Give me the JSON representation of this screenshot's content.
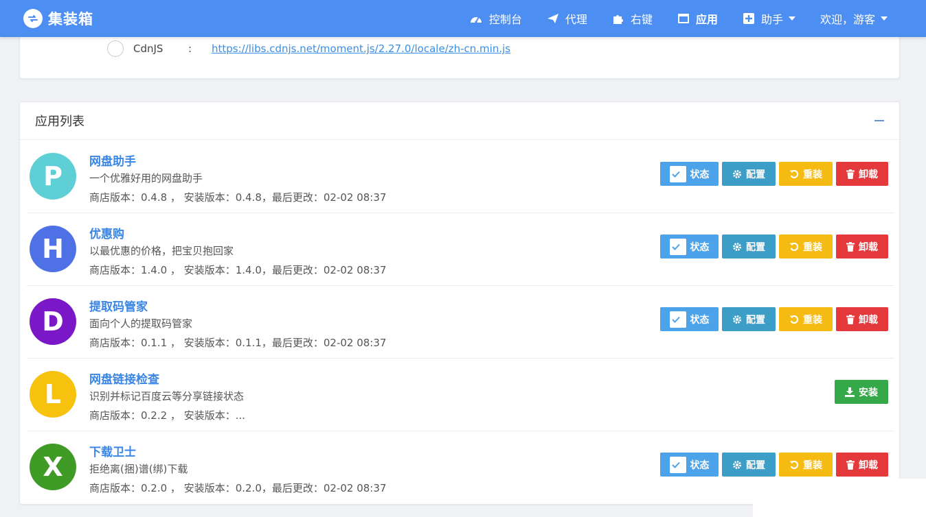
{
  "navbar": {
    "brand": "集装箱",
    "items": [
      {
        "label": "控制台",
        "icon": "dashboard-icon"
      },
      {
        "label": "代理",
        "icon": "paper-plane-icon"
      },
      {
        "label": "右键",
        "icon": "puzzle-icon"
      },
      {
        "label": "应用",
        "icon": "window-icon"
      },
      {
        "label": "助手",
        "icon": "plus-square-icon"
      }
    ],
    "welcome": "欢迎，游客"
  },
  "cdn": {
    "label": "CdnJS",
    "separator": ":",
    "url": "https://libs.cdnjs.net/moment.js/2.27.0/locale/zh-cn.min.js"
  },
  "app_list": {
    "title": "应用列表",
    "buttons": {
      "status": "状态",
      "config": "配置",
      "reinstall": "重装",
      "uninstall": "卸载",
      "install": "安装"
    },
    "apps": [
      {
        "letter": "P",
        "color": "#5fcfd6",
        "name": "网盘助手",
        "desc": "一个优雅好用的网盘助手",
        "meta": "商店版本：0.4.8 ， 安装版本：0.4.8，最后更改：02-02 08:37"
      },
      {
        "letter": "H",
        "color": "#4f71e6",
        "name": "优惠购",
        "desc": "以最优惠的价格，把宝贝抱回家",
        "meta": "商店版本：1.4.0 ， 安装版本：1.4.0，最后更改：02-02 08:37"
      },
      {
        "letter": "D",
        "color": "#7a17c6",
        "name": "提取码管家",
        "desc": "面向个人的提取码管家",
        "meta": "商店版本：0.1.1 ， 安装版本：0.1.1，最后更改：02-02 08:37"
      },
      {
        "letter": "L",
        "color": "#f7c20e",
        "name": "网盘链接检查",
        "desc": "识别并标记百度云等分享链接状态",
        "meta": "商店版本：0.2.2 ， 安装版本：..."
      },
      {
        "letter": "X",
        "color": "#3f9a26",
        "name": "下载卫士",
        "desc": "拒绝离(捆)谱(绑)下载",
        "meta": "商店版本：0.2.0 ， 安装版本：0.2.0，最后更改：02-02 08:37"
      }
    ]
  }
}
